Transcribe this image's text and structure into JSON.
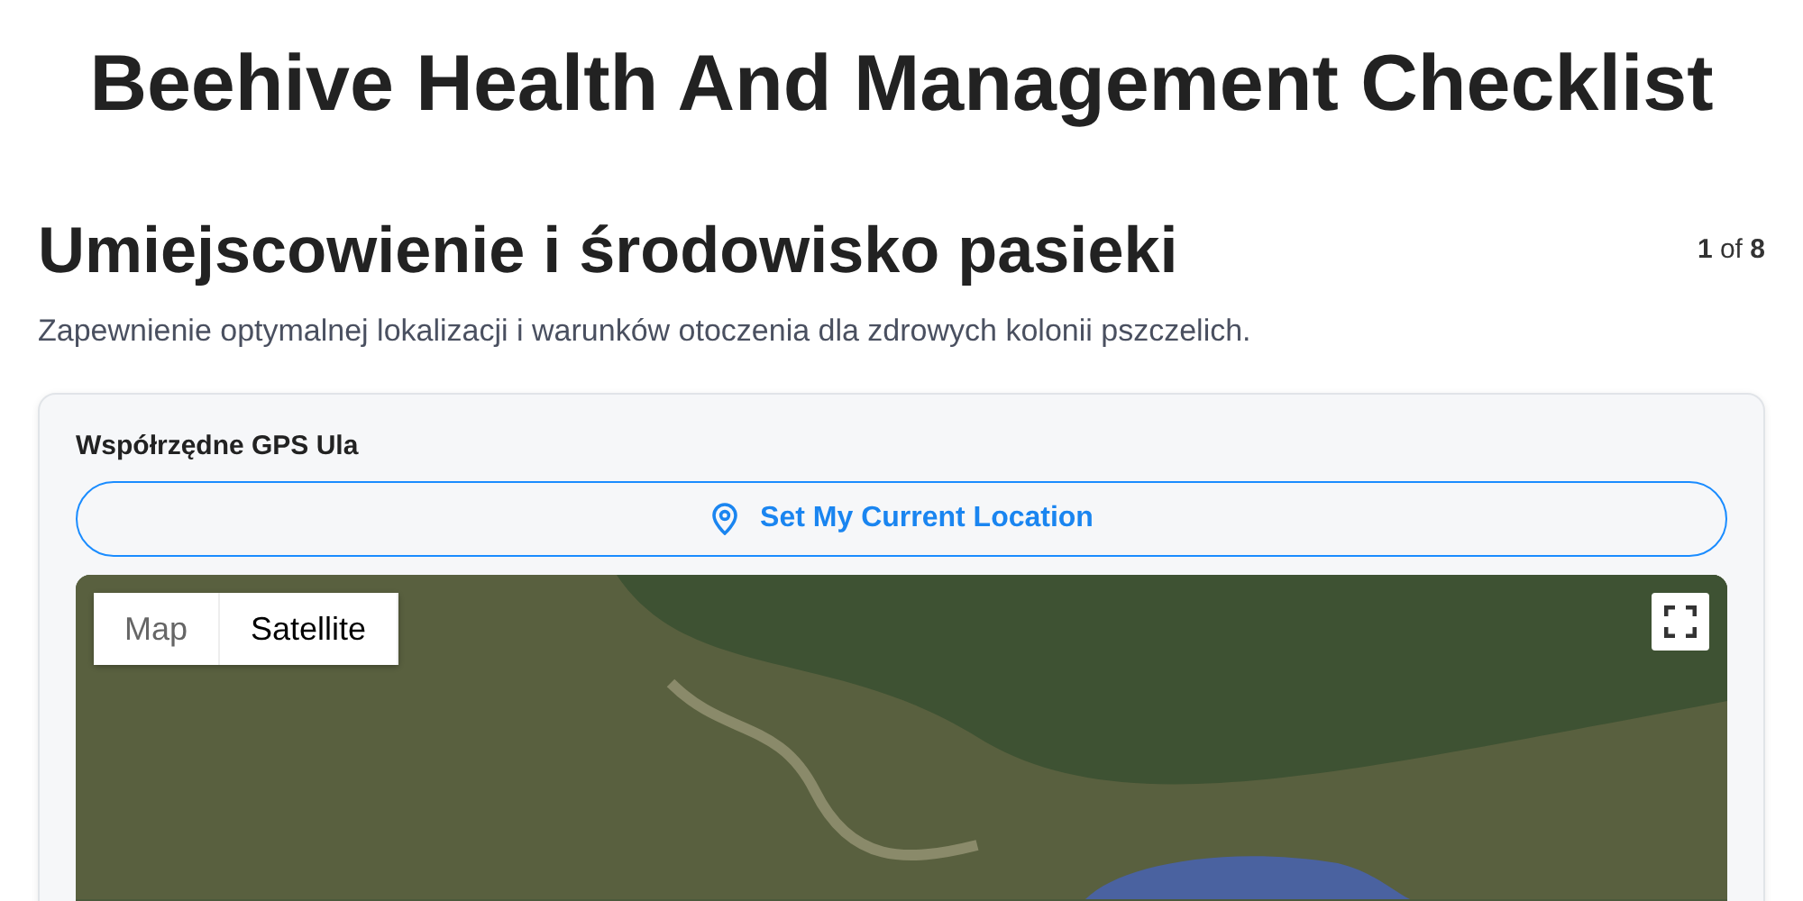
{
  "title": "Beehive Health And Management Checklist",
  "section": {
    "heading": "Umiejscowienie i środowisko pasieki",
    "counter": "**1** of **8**",
    "description": "Zapewnienie optymalnej lokalizacji i warunków otoczenia dla zdrowych kolonii pszczelich."
  },
  "field": {
    "label": "Współrzędne GPS Ula",
    "button": "Set My Current Location"
  },
  "map": {
    "types": [
      {
        "label": "Map",
        "selected": false
      },
      {
        "label": "Satellite",
        "selected": true
      }
    ]
  }
}
